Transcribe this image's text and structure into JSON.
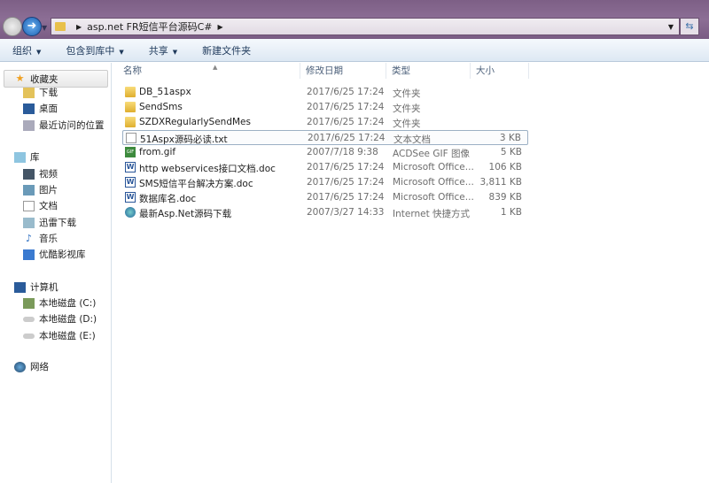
{
  "address": {
    "path": [
      "asp.net FR短信平台源码C#"
    ]
  },
  "toolbar": {
    "organize": "组织",
    "include": "包含到库中",
    "share": "共享",
    "new_folder": "新建文件夹"
  },
  "sidebar": {
    "favorites": {
      "label": "收藏夹",
      "items": [
        "下载",
        "桌面",
        "最近访问的位置"
      ]
    },
    "libraries": {
      "label": "库",
      "items": [
        "视频",
        "图片",
        "文档",
        "迅雷下载",
        "音乐",
        "优酷影视库"
      ]
    },
    "computer": {
      "label": "计算机",
      "items": [
        "本地磁盘 (C:)",
        "本地磁盘 (D:)",
        "本地磁盘 (E:)"
      ]
    },
    "network": {
      "label": "网络"
    }
  },
  "columns": {
    "name": "名称",
    "date": "修改日期",
    "type": "类型",
    "size": "大小"
  },
  "files": [
    {
      "name": "DB_51aspx",
      "date": "2017/6/25 17:24",
      "type": "文件夹",
      "size": "",
      "icon": "folder"
    },
    {
      "name": "SendSms",
      "date": "2017/6/25 17:24",
      "type": "文件夹",
      "size": "",
      "icon": "folder"
    },
    {
      "name": "SZDXRegularlySendMes",
      "date": "2017/6/25 17:24",
      "type": "文件夹",
      "size": "",
      "icon": "folder"
    },
    {
      "name": "51Aspx源码必读.txt",
      "date": "2017/6/25 17:24",
      "type": "文本文档",
      "size": "3 KB",
      "icon": "txt"
    },
    {
      "name": "from.gif",
      "date": "2007/7/18 9:38",
      "type": "ACDSee GIF 图像",
      "size": "5 KB",
      "icon": "gif"
    },
    {
      "name": "http webservices接口文档.doc",
      "date": "2017/6/25 17:24",
      "type": "Microsoft Office...",
      "size": "106 KB",
      "icon": "doc"
    },
    {
      "name": "SMS短信平台解决方案.doc",
      "date": "2017/6/25 17:24",
      "type": "Microsoft Office...",
      "size": "3,811 KB",
      "icon": "doc"
    },
    {
      "name": "数据库名.doc",
      "date": "2017/6/25 17:24",
      "type": "Microsoft Office...",
      "size": "839 KB",
      "icon": "doc"
    },
    {
      "name": "最新Asp.Net源码下载",
      "date": "2007/3/27 14:33",
      "type": "Internet 快捷方式",
      "size": "1 KB",
      "icon": "url"
    }
  ]
}
